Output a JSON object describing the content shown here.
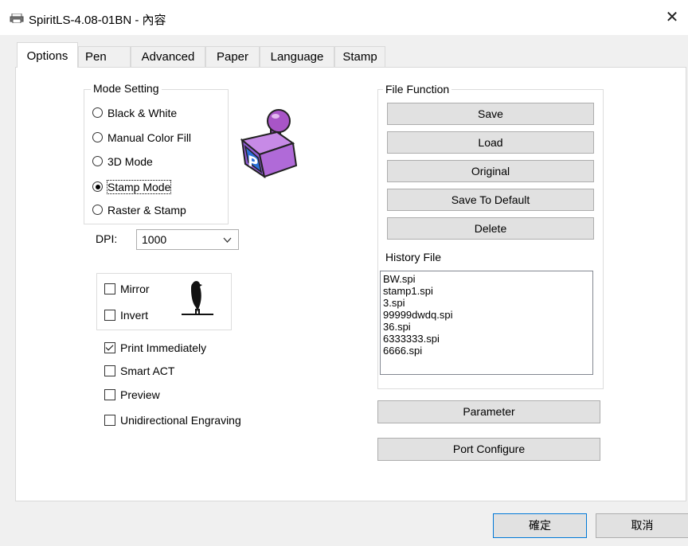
{
  "window": {
    "title": "SpiritLS-4.08-01BN - 內容",
    "app_icon": "printer-icon",
    "close_glyph": "✕"
  },
  "tabs": [
    {
      "label": "Options",
      "active": true
    },
    {
      "label": "Pen"
    },
    {
      "label": "Advanced"
    },
    {
      "label": "Paper"
    },
    {
      "label": "Language"
    },
    {
      "label": "Stamp"
    }
  ],
  "mode_setting": {
    "legend": "Mode Setting",
    "options": [
      {
        "label": "Black & White",
        "selected": false
      },
      {
        "label": "Manual Color Fill",
        "selected": false
      },
      {
        "label": "3D Mode",
        "selected": false
      },
      {
        "label": "Stamp Mode",
        "selected": true
      },
      {
        "label": "Raster & Stamp",
        "selected": false
      }
    ],
    "image": "stamp-icon"
  },
  "dpi": {
    "label": "DPI:",
    "value": "1000"
  },
  "image_options": {
    "mirror": {
      "label": "Mirror",
      "checked": false
    },
    "invert": {
      "label": "Invert",
      "checked": false
    },
    "image": "bird-icon"
  },
  "options": [
    {
      "label": "Print Immediately",
      "checked": true
    },
    {
      "label": "Smart ACT",
      "checked": false
    },
    {
      "label": "Preview",
      "checked": false
    },
    {
      "label": "Unidirectional Engraving",
      "checked": false
    }
  ],
  "file_function": {
    "legend": "File Function",
    "buttons": [
      "Save",
      "Load",
      "Original",
      "Save To Default",
      "Delete"
    ],
    "history_label": "History File",
    "history_files": [
      "BW.spi",
      "stamp1.spi",
      "3.spi",
      "99999dwdq.spi",
      "36.spi",
      "6333333.spi",
      "6666.spi"
    ]
  },
  "parameter_button": "Parameter",
  "port_configure_button": "Port Configure",
  "footer": {
    "ok": "確定",
    "cancel": "取消"
  }
}
